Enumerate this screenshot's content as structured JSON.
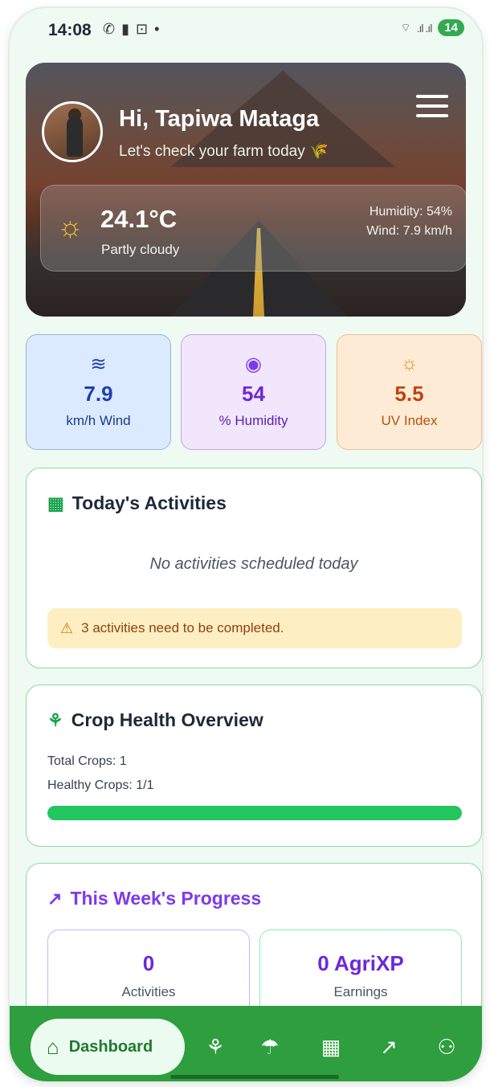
{
  "status_bar": {
    "time": "14:08",
    "icons_left": [
      "whatsapp-icon",
      "battery-saver-icon",
      "screenshot-icon",
      "dot-icon"
    ],
    "signal": ".ıl .ıl",
    "battery": "14"
  },
  "hero": {
    "greeting": "Hi, Tapiwa Mataga",
    "subgreeting": "Let's check your farm today 🌾",
    "weather": {
      "temperature": "24.1°C",
      "condition": "Partly cloudy",
      "humidity": "Humidity: 54%",
      "wind": "Wind: 7.9 km/h"
    }
  },
  "stats": [
    {
      "icon": "wind-icon",
      "value": "7.9",
      "label": "km/h Wind"
    },
    {
      "icon": "eye-icon",
      "value": "54",
      "label": "% Humidity"
    },
    {
      "icon": "sun-icon",
      "value": "5.5",
      "label": "UV Index"
    }
  ],
  "activities": {
    "title": "Today's Activities",
    "empty_message": "No activities scheduled today",
    "warning": "3 activities need to be completed."
  },
  "crop_health": {
    "title": "Crop Health Overview",
    "total": "Total Crops: 1",
    "healthy": "Healthy Crops: 1/1",
    "healthy_fraction": 1.0
  },
  "progress": {
    "title": "This Week's Progress",
    "activities_value": "0",
    "activities_label": "Activities",
    "earnings_value": "0 AgriXP",
    "earnings_label": "Earnings"
  },
  "nav": {
    "active_label": "Dashboard",
    "items": [
      "home-icon",
      "sprout-icon",
      "cloud-rain-icon",
      "calendar-icon",
      "trending-up-icon",
      "users-icon"
    ]
  },
  "colors": {
    "primary_green": "#2e9e3e",
    "accent_purple": "#7c3aed",
    "warning_bg": "#fdefc3"
  }
}
